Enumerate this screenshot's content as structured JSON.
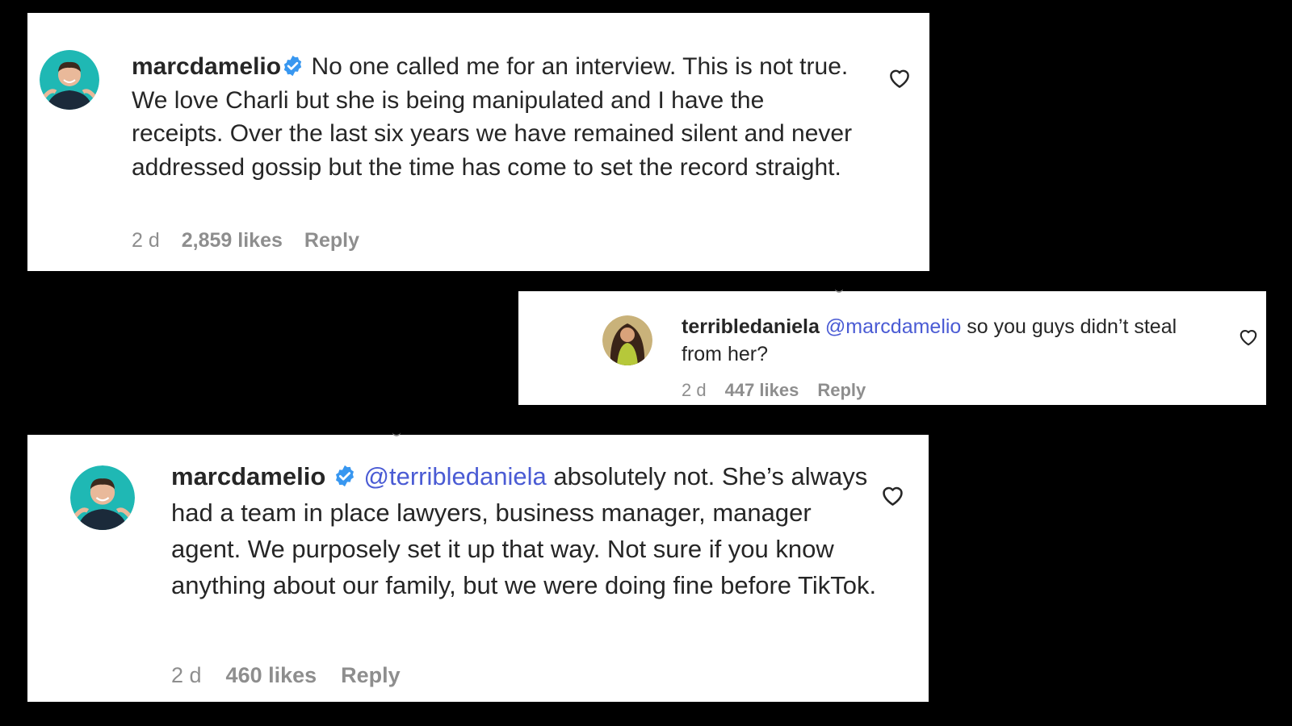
{
  "comments": [
    {
      "username": "marcdamelio",
      "verified": true,
      "mention": "",
      "text": "No one called me for an interview. This is not true. We love Charli but she is being manipulated and I have the receipts. Over the last six years we have remained silent and never addressed gossip but the time has come to set the record straight.",
      "time": "2 d",
      "likes": "2,859 likes",
      "reply": "Reply",
      "avatar_icon": "man-avatar",
      "like_icon": "heart-outline-icon"
    },
    {
      "username": "terribledaniela",
      "verified": false,
      "mention": "@marcdamelio",
      "text": "so you guys didn’t steal from her?",
      "time": "2 d",
      "likes": "447 likes",
      "reply": "Reply",
      "avatar_icon": "woman-avatar",
      "like_icon": "heart-outline-icon"
    },
    {
      "username": "marcdamelio",
      "verified": true,
      "mention": "@terribledaniela",
      "text": "absolutely not. She’s always had a team in place lawyers, business manager, manager agent. We purposely set it up that way. Not sure if you know anything about our family, but we were doing fine before TikTok.",
      "time": "2 d",
      "likes": "460 likes",
      "reply": "Reply",
      "avatar_icon": "man-avatar",
      "like_icon": "heart-outline-icon"
    }
  ],
  "colors": {
    "background": "#000000",
    "card": "#ffffff",
    "text": "#262626",
    "meta": "#8e8e8e",
    "mention": "#4a5bd4",
    "verified": "#3897f0",
    "avatar_bg_man": "#1fb8b4"
  }
}
